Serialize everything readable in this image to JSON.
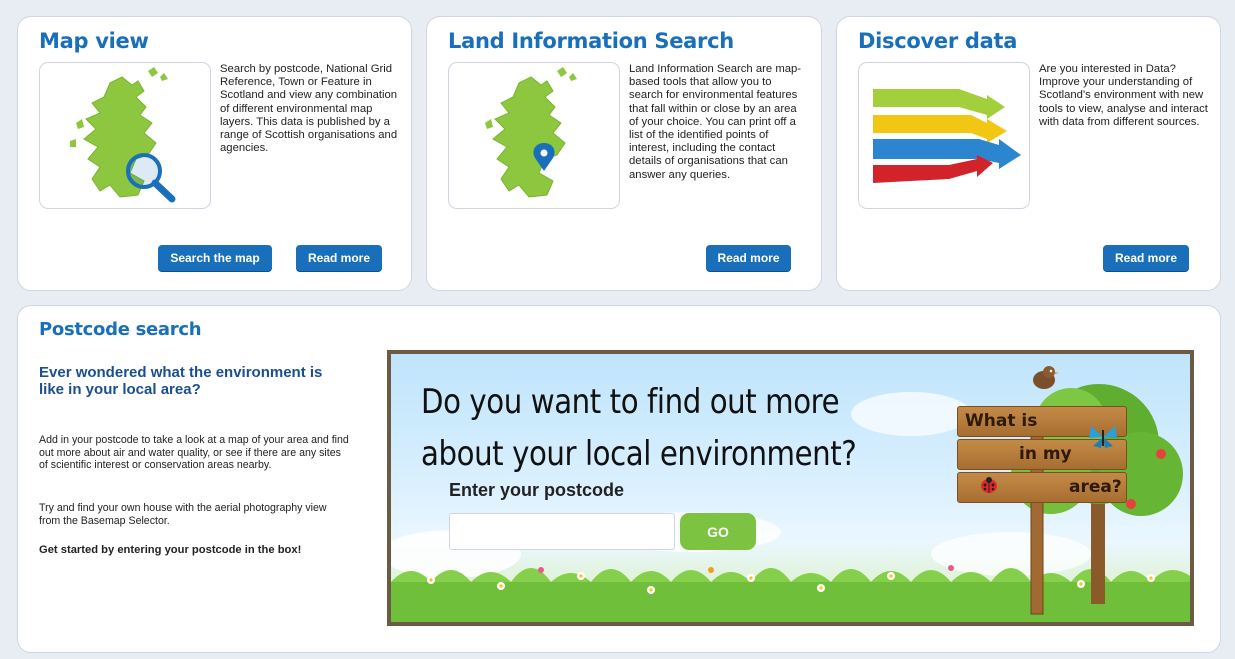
{
  "cards": [
    {
      "title": "Map view",
      "description": "Search by postcode, National Grid Reference, Town or Feature in Scotland and view any combination of different environmental map layers. This data is published by a range of Scottish organisations and agencies.",
      "buttons": [
        "Search the map",
        "Read more"
      ],
      "icon": "scotland-map-magnifier-icon"
    },
    {
      "title": "Land Information Search",
      "description": "Land Information Search are map-based tools that allow you to search for environmental features that fall within or close by an area of your choice. You can print off a list of the identified points of interest, including the contact details of organisations that can answer any queries.",
      "buttons": [
        "Read more"
      ],
      "icon": "scotland-map-pin-icon"
    },
    {
      "title": "Discover data",
      "description": "Are you interested in Data? Improve your understanding of Scotland's environment with new tools to view, analyse and interact with data from different sources.",
      "buttons": [
        "Read more"
      ],
      "icon": "data-arrows-icon"
    }
  ],
  "postcode": {
    "title": "Postcode search",
    "heading": "Ever wondered what the environment is like in your local area?",
    "paragraph1": "Add in your postcode to take a look at a map of your area and find out more about air and water quality, or see if there are any sites of scientific interest or conservation areas nearby.",
    "paragraph2": "Try and find your own house with the aerial photography view from the Basemap Selector.",
    "paragraph3": "Get started by entering your postcode in the box!",
    "banner_question_line1": "Do you want to find out more",
    "banner_question_line2": "about your local environment?",
    "input_label": "Enter your postcode",
    "input_value": "",
    "input_placeholder": "",
    "go_label": "GO",
    "sign_line1": "What is",
    "sign_line2": "in my",
    "sign_line3": "area?"
  },
  "colors": {
    "brand_blue": "#1a6fba",
    "heading_blue": "#1a4f8f",
    "go_green": "#7cc341",
    "scotland_green": "#8dc63f"
  }
}
